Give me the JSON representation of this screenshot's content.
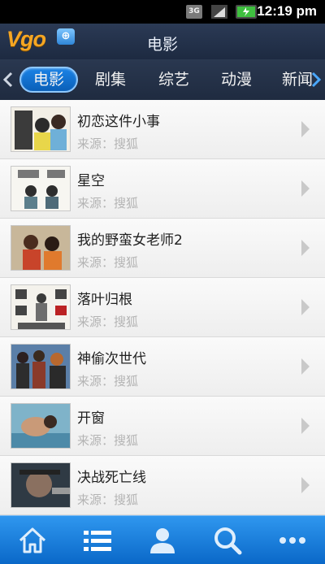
{
  "status_bar": {
    "network_label": "3G",
    "time": "12:19 pm",
    "icons": [
      "3g-icon",
      "signal-icon",
      "battery-icon"
    ]
  },
  "header": {
    "logo_text": "Vgo",
    "logo_badge": "⊕",
    "title": "电影"
  },
  "tabs": [
    {
      "label": "电影",
      "active": true
    },
    {
      "label": "剧集",
      "active": false
    },
    {
      "label": "综艺",
      "active": false
    },
    {
      "label": "动漫",
      "active": false
    },
    {
      "label": "新闻",
      "active": false
    }
  ],
  "items": [
    {
      "title": "初恋这件小事",
      "source": "来源：搜狐"
    },
    {
      "title": "星空",
      "source": "来源：搜狐"
    },
    {
      "title": "我的野蛮女老师2",
      "source": "来源：搜狐"
    },
    {
      "title": "落叶归根",
      "source": "来源：搜狐"
    },
    {
      "title": "神偷次世代",
      "source": "来源：搜狐"
    },
    {
      "title": "开窗",
      "source": "来源：搜狐"
    },
    {
      "title": "决战死亡线",
      "source": "来源：搜狐"
    }
  ],
  "bottom_nav": [
    {
      "icon": "home-icon"
    },
    {
      "icon": "list-icon"
    },
    {
      "icon": "user-icon"
    },
    {
      "icon": "search-icon"
    },
    {
      "icon": "more-icon"
    }
  ],
  "colors": {
    "accent": "#1b83e6",
    "header_bg": "#253450",
    "nav_bg": "#1a80de",
    "logo": "#f5a623"
  }
}
